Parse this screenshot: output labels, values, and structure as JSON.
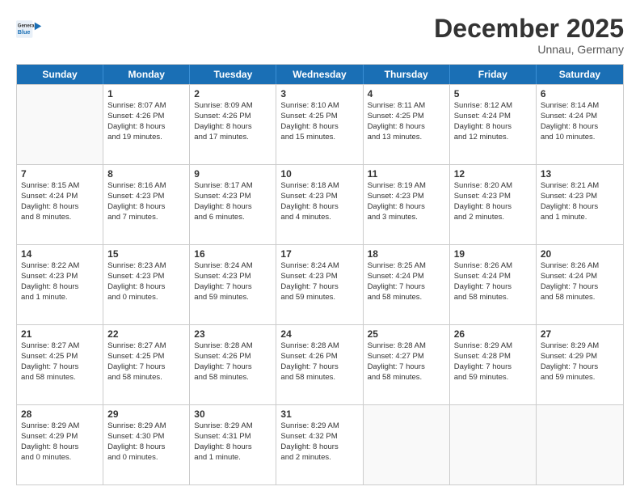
{
  "logo": {
    "line1": "General",
    "line2": "Blue"
  },
  "title": "December 2025",
  "subtitle": "Unnau, Germany",
  "days_of_week": [
    "Sunday",
    "Monday",
    "Tuesday",
    "Wednesday",
    "Thursday",
    "Friday",
    "Saturday"
  ],
  "weeks": [
    [
      {
        "day": "",
        "info": ""
      },
      {
        "day": "1",
        "info": "Sunrise: 8:07 AM\nSunset: 4:26 PM\nDaylight: 8 hours\nand 19 minutes."
      },
      {
        "day": "2",
        "info": "Sunrise: 8:09 AM\nSunset: 4:26 PM\nDaylight: 8 hours\nand 17 minutes."
      },
      {
        "day": "3",
        "info": "Sunrise: 8:10 AM\nSunset: 4:25 PM\nDaylight: 8 hours\nand 15 minutes."
      },
      {
        "day": "4",
        "info": "Sunrise: 8:11 AM\nSunset: 4:25 PM\nDaylight: 8 hours\nand 13 minutes."
      },
      {
        "day": "5",
        "info": "Sunrise: 8:12 AM\nSunset: 4:24 PM\nDaylight: 8 hours\nand 12 minutes."
      },
      {
        "day": "6",
        "info": "Sunrise: 8:14 AM\nSunset: 4:24 PM\nDaylight: 8 hours\nand 10 minutes."
      }
    ],
    [
      {
        "day": "7",
        "info": "Sunrise: 8:15 AM\nSunset: 4:24 PM\nDaylight: 8 hours\nand 8 minutes."
      },
      {
        "day": "8",
        "info": "Sunrise: 8:16 AM\nSunset: 4:23 PM\nDaylight: 8 hours\nand 7 minutes."
      },
      {
        "day": "9",
        "info": "Sunrise: 8:17 AM\nSunset: 4:23 PM\nDaylight: 8 hours\nand 6 minutes."
      },
      {
        "day": "10",
        "info": "Sunrise: 8:18 AM\nSunset: 4:23 PM\nDaylight: 8 hours\nand 4 minutes."
      },
      {
        "day": "11",
        "info": "Sunrise: 8:19 AM\nSunset: 4:23 PM\nDaylight: 8 hours\nand 3 minutes."
      },
      {
        "day": "12",
        "info": "Sunrise: 8:20 AM\nSunset: 4:23 PM\nDaylight: 8 hours\nand 2 minutes."
      },
      {
        "day": "13",
        "info": "Sunrise: 8:21 AM\nSunset: 4:23 PM\nDaylight: 8 hours\nand 1 minute."
      }
    ],
    [
      {
        "day": "14",
        "info": "Sunrise: 8:22 AM\nSunset: 4:23 PM\nDaylight: 8 hours\nand 1 minute."
      },
      {
        "day": "15",
        "info": "Sunrise: 8:23 AM\nSunset: 4:23 PM\nDaylight: 8 hours\nand 0 minutes."
      },
      {
        "day": "16",
        "info": "Sunrise: 8:24 AM\nSunset: 4:23 PM\nDaylight: 7 hours\nand 59 minutes."
      },
      {
        "day": "17",
        "info": "Sunrise: 8:24 AM\nSunset: 4:23 PM\nDaylight: 7 hours\nand 59 minutes."
      },
      {
        "day": "18",
        "info": "Sunrise: 8:25 AM\nSunset: 4:24 PM\nDaylight: 7 hours\nand 58 minutes."
      },
      {
        "day": "19",
        "info": "Sunrise: 8:26 AM\nSunset: 4:24 PM\nDaylight: 7 hours\nand 58 minutes."
      },
      {
        "day": "20",
        "info": "Sunrise: 8:26 AM\nSunset: 4:24 PM\nDaylight: 7 hours\nand 58 minutes."
      }
    ],
    [
      {
        "day": "21",
        "info": "Sunrise: 8:27 AM\nSunset: 4:25 PM\nDaylight: 7 hours\nand 58 minutes."
      },
      {
        "day": "22",
        "info": "Sunrise: 8:27 AM\nSunset: 4:25 PM\nDaylight: 7 hours\nand 58 minutes."
      },
      {
        "day": "23",
        "info": "Sunrise: 8:28 AM\nSunset: 4:26 PM\nDaylight: 7 hours\nand 58 minutes."
      },
      {
        "day": "24",
        "info": "Sunrise: 8:28 AM\nSunset: 4:26 PM\nDaylight: 7 hours\nand 58 minutes."
      },
      {
        "day": "25",
        "info": "Sunrise: 8:28 AM\nSunset: 4:27 PM\nDaylight: 7 hours\nand 58 minutes."
      },
      {
        "day": "26",
        "info": "Sunrise: 8:29 AM\nSunset: 4:28 PM\nDaylight: 7 hours\nand 59 minutes."
      },
      {
        "day": "27",
        "info": "Sunrise: 8:29 AM\nSunset: 4:29 PM\nDaylight: 7 hours\nand 59 minutes."
      }
    ],
    [
      {
        "day": "28",
        "info": "Sunrise: 8:29 AM\nSunset: 4:29 PM\nDaylight: 8 hours\nand 0 minutes."
      },
      {
        "day": "29",
        "info": "Sunrise: 8:29 AM\nSunset: 4:30 PM\nDaylight: 8 hours\nand 0 minutes."
      },
      {
        "day": "30",
        "info": "Sunrise: 8:29 AM\nSunset: 4:31 PM\nDaylight: 8 hours\nand 1 minute."
      },
      {
        "day": "31",
        "info": "Sunrise: 8:29 AM\nSunset: 4:32 PM\nDaylight: 8 hours\nand 2 minutes."
      },
      {
        "day": "",
        "info": ""
      },
      {
        "day": "",
        "info": ""
      },
      {
        "day": "",
        "info": ""
      }
    ]
  ]
}
